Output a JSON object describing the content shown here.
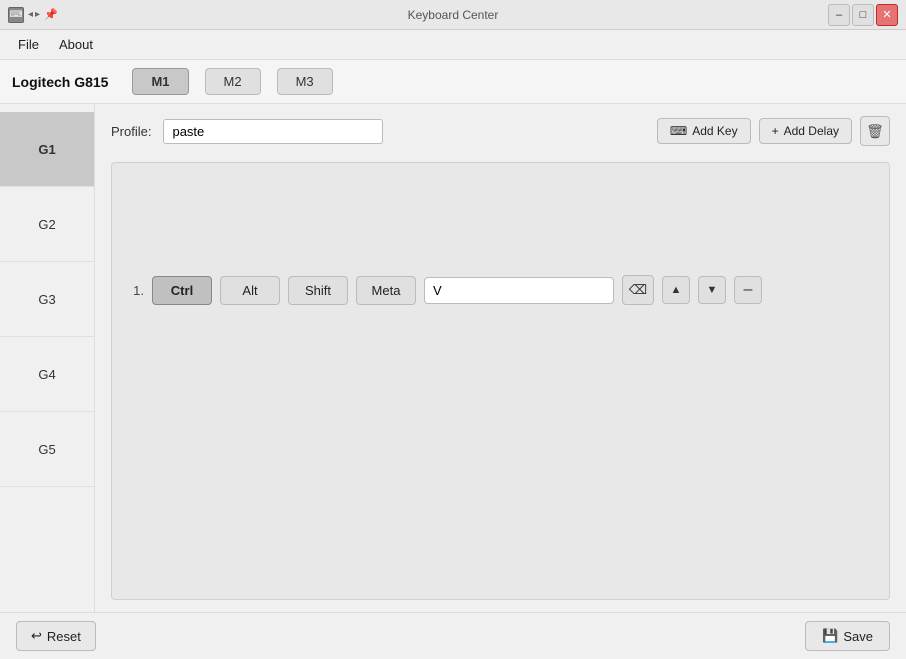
{
  "titlebar": {
    "title": "Keyboard Center",
    "minimize_label": "–",
    "maximize_label": "□",
    "close_label": "✕"
  },
  "menubar": {
    "items": [
      {
        "id": "file",
        "label": "File"
      },
      {
        "id": "about",
        "label": "About"
      }
    ]
  },
  "device": {
    "name": "Logitech G815",
    "modes": [
      {
        "id": "m1",
        "label": "M1",
        "active": true
      },
      {
        "id": "m2",
        "label": "M2",
        "active": false
      },
      {
        "id": "m3",
        "label": "M3",
        "active": false
      }
    ]
  },
  "profile": {
    "label": "Profile:",
    "value": "paste"
  },
  "toolbar": {
    "add_key_icon": "⌨",
    "add_key_label": "Add Key",
    "add_delay_icon": "+",
    "add_delay_label": "Add Delay",
    "delete_icon": "🗑"
  },
  "g_keys": [
    {
      "id": "g1",
      "label": "G1",
      "active": true
    },
    {
      "id": "g2",
      "label": "G2",
      "active": false
    },
    {
      "id": "g3",
      "label": "G3",
      "active": false
    },
    {
      "id": "g4",
      "label": "G4",
      "active": false
    },
    {
      "id": "g5",
      "label": "G5",
      "active": false
    }
  ],
  "key_entries": [
    {
      "number": "1.",
      "ctrl": {
        "label": "Ctrl",
        "active": true
      },
      "alt": {
        "label": "Alt",
        "active": false
      },
      "shift": {
        "label": "Shift",
        "active": false
      },
      "meta": {
        "label": "Meta",
        "active": false
      },
      "key_value": "V"
    }
  ],
  "bottom": {
    "reset_icon": "↩",
    "reset_label": "Reset",
    "save_icon": "💾",
    "save_label": "Save"
  }
}
